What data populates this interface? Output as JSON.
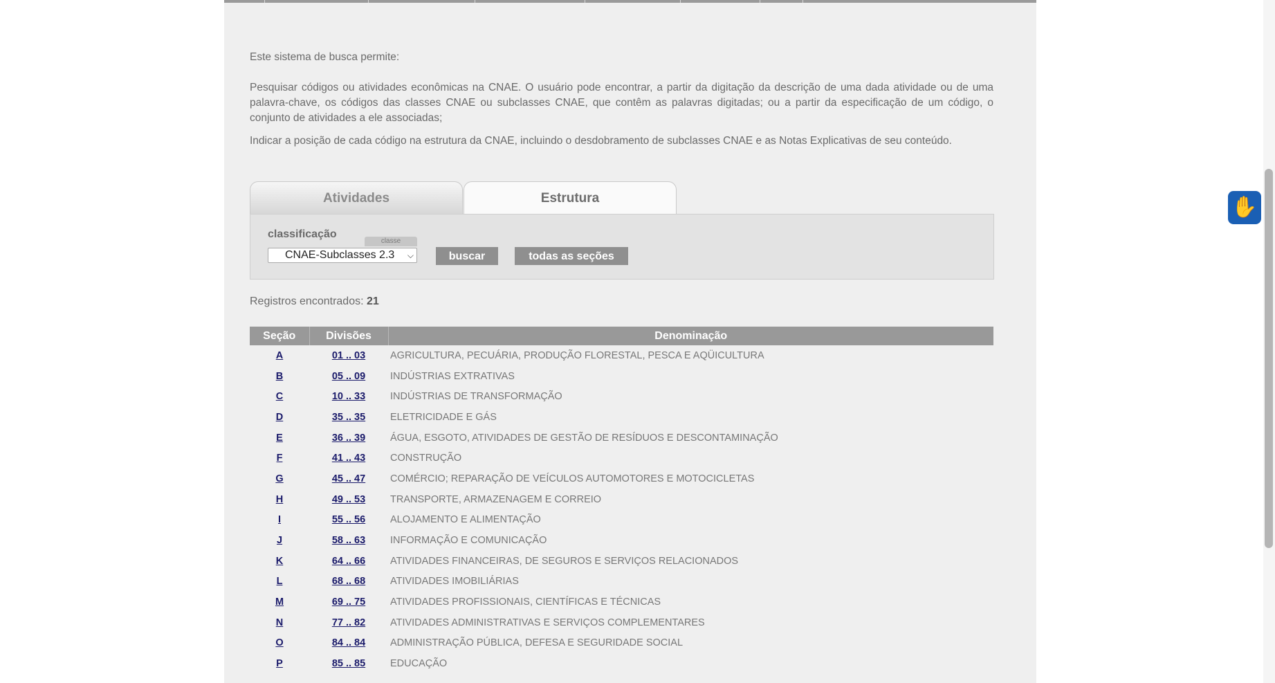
{
  "intro": {
    "p1": "Este sistema de busca permite:",
    "p2": "Pesquisar códigos ou atividades econômicas na CNAE. O usuário pode encontrar, a partir da digitação da descrição de uma dada atividade ou de uma palavra-chave, os códigos das classes CNAE ou subclasses CNAE, que contêm as palavras digitadas; ou a partir da especificação de um código, o conjunto de atividades a ele associadas;",
    "p3": "Indicar a posição de cada código na estrutura da CNAE, incluindo o desdobramento de subclasses CNAE e as Notas Explicativas de seu conteúdo."
  },
  "tabs": {
    "atividades": "Atividades",
    "estrutura": "Estrutura"
  },
  "form": {
    "label": "classificação",
    "tag": "classe",
    "select_value": "CNAE-Subclasses 2.3",
    "buscar": "buscar",
    "todas": "todas as seções"
  },
  "registros": {
    "label": "Registros encontrados:",
    "count": "21"
  },
  "table": {
    "headers": [
      "Seção",
      "Divisões",
      "Denominação"
    ],
    "rows": [
      {
        "secao": "A",
        "divisoes": "01 .. 03",
        "denominacao": "AGRICULTURA, PECUÁRIA, PRODUÇÃO FLORESTAL, PESCA E AQÜICULTURA"
      },
      {
        "secao": "B",
        "divisoes": "05 .. 09",
        "denominacao": "INDÚSTRIAS EXTRATIVAS"
      },
      {
        "secao": "C",
        "divisoes": "10 .. 33",
        "denominacao": "INDÚSTRIAS DE TRANSFORMAÇÃO"
      },
      {
        "secao": "D",
        "divisoes": "35 .. 35",
        "denominacao": "ELETRICIDADE E GÁS"
      },
      {
        "secao": "E",
        "divisoes": "36 .. 39",
        "denominacao": "ÁGUA, ESGOTO, ATIVIDADES DE GESTÃO DE RESÍDUOS E DESCONTAMINAÇÃO"
      },
      {
        "secao": "F",
        "divisoes": "41 .. 43",
        "denominacao": "CONSTRUÇÃO"
      },
      {
        "secao": "G",
        "divisoes": "45 .. 47",
        "denominacao": "COMÉRCIO; REPARAÇÃO DE VEÍCULOS AUTOMOTORES E MOTOCICLETAS"
      },
      {
        "secao": "H",
        "divisoes": "49 .. 53",
        "denominacao": "TRANSPORTE, ARMAZENAGEM E CORREIO"
      },
      {
        "secao": "I",
        "divisoes": "55 .. 56",
        "denominacao": "ALOJAMENTO E ALIMENTAÇÃO"
      },
      {
        "secao": "J",
        "divisoes": "58 .. 63",
        "denominacao": "INFORMAÇÃO E COMUNICAÇÃO"
      },
      {
        "secao": "K",
        "divisoes": "64 .. 66",
        "denominacao": "ATIVIDADES FINANCEIRAS, DE SEGUROS E SERVIÇOS RELACIONADOS"
      },
      {
        "secao": "L",
        "divisoes": "68 .. 68",
        "denominacao": "ATIVIDADES IMOBILIÁRIAS"
      },
      {
        "secao": "M",
        "divisoes": "69 .. 75",
        "denominacao": "ATIVIDADES PROFISSIONAIS, CIENTÍFICAS E TÉCNICAS"
      },
      {
        "secao": "N",
        "divisoes": "77 .. 82",
        "denominacao": "ATIVIDADES ADMINISTRATIVAS E SERVIÇOS COMPLEMENTARES"
      },
      {
        "secao": "O",
        "divisoes": "84 .. 84",
        "denominacao": "ADMINISTRAÇÃO PÚBLICA, DEFESA E SEGURIDADE SOCIAL"
      },
      {
        "secao": "P",
        "divisoes": "85 .. 85",
        "denominacao": "EDUCAÇÃO"
      }
    ]
  },
  "widgets": {
    "vlibras_icon": "sign-language-hands-icon"
  }
}
